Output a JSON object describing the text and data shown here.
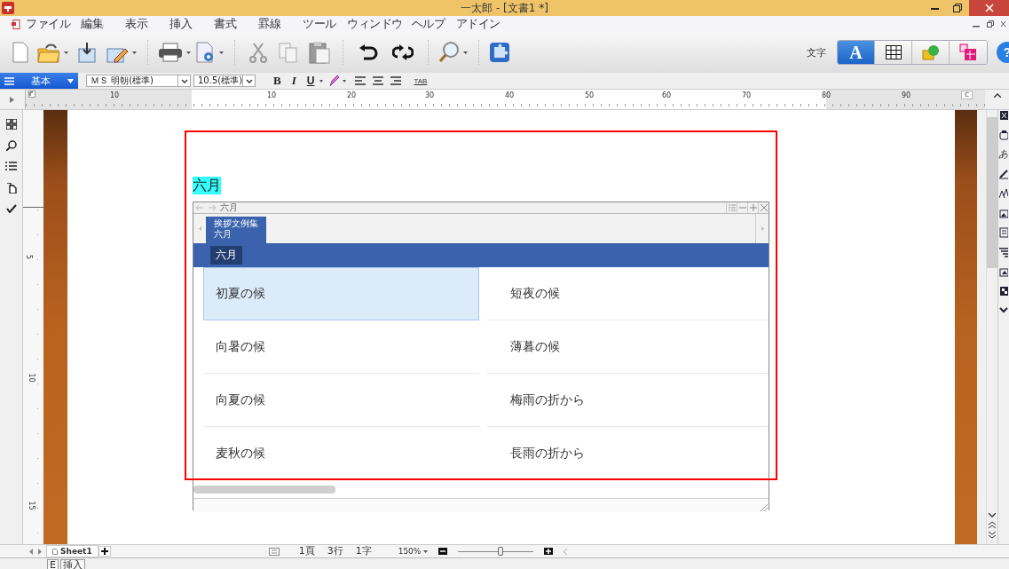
{
  "window": {
    "title": "一太郎 - [文書1 *]"
  },
  "menu": [
    "ファイル",
    "編集",
    "表示",
    "挿入",
    "書式",
    "罫線",
    "ツール",
    "ウィンドウ",
    "ヘルプ",
    "アドイン"
  ],
  "toolbar": {
    "mode_label": "文字",
    "help": "?",
    "modes": [
      {
        "kind": "text",
        "label": "A",
        "selected": true
      },
      {
        "kind": "table",
        "selected": false
      },
      {
        "kind": "shape",
        "selected": false
      },
      {
        "kind": "layout",
        "selected": false
      }
    ]
  },
  "format_bar": {
    "style": "基本",
    "font": "ＭＳ 明朝(標準)",
    "size": "10.5(標準)",
    "bold": "B",
    "italic": "I",
    "underline": "U",
    "tab": "TAB"
  },
  "ruler": {
    "numbers": [
      "10",
      "10",
      "20",
      "30",
      "40",
      "50",
      "60",
      "70",
      "80",
      "90"
    ],
    "end_mark": "C"
  },
  "vertical_ruler": {
    "numbers": [
      "5",
      "10",
      "15"
    ]
  },
  "right_tools": {
    "text_tool": "あ"
  },
  "document": {
    "heading": "六月",
    "heading_highlighted": true
  },
  "palette": {
    "path": "六月",
    "tab": {
      "title": "挨拶文例集",
      "subtitle": "六月"
    },
    "category": "六月",
    "items": [
      {
        "text": "初夏の候",
        "selected": true
      },
      {
        "text": "短夜の候",
        "selected": false
      },
      {
        "text": "向暑の候",
        "selected": false
      },
      {
        "text": "薄暮の候",
        "selected": false
      },
      {
        "text": "向夏の候",
        "selected": false
      },
      {
        "text": "梅雨の折から",
        "selected": false
      },
      {
        "text": "麦秋の候",
        "selected": false
      },
      {
        "text": "長雨の折から",
        "selected": false
      }
    ]
  },
  "status_bar": {
    "sheet": "Sheet1",
    "page": "1頁",
    "line": "3行",
    "char": "1字",
    "zoom": "150%",
    "zoom_slider": {
      "level": 0.56
    }
  },
  "input_bar": {
    "mode_key": "E",
    "mode": "挿入"
  }
}
